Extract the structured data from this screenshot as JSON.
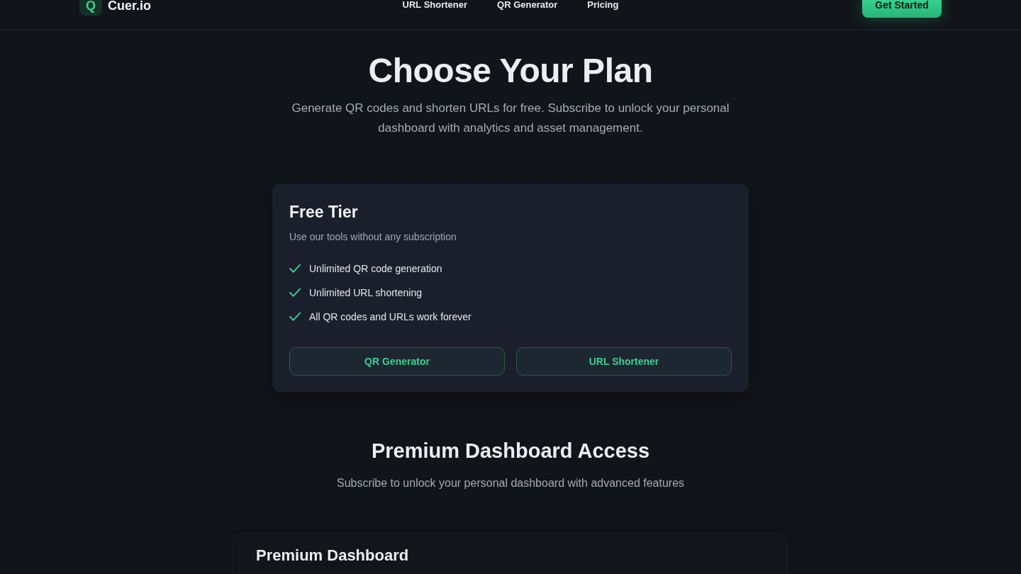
{
  "header": {
    "logo": {
      "mark": "Q",
      "name": "Cuer.io"
    },
    "nav": [
      {
        "label": "URL Shortener"
      },
      {
        "label": "QR Generator"
      },
      {
        "label": "Pricing"
      }
    ],
    "cta": "Get Started"
  },
  "hero": {
    "title": "Choose Your Plan",
    "subtitle": "Generate QR codes and shorten URLs for free. Subscribe to unlock your personal dashboard with analytics and asset management."
  },
  "free_tier": {
    "title": "Free Tier",
    "description": "Use our tools without any subscription",
    "features": [
      "Unlimited QR code generation",
      "Unlimited URL shortening",
      "All QR codes and URLs work forever"
    ],
    "buttons": [
      "QR Generator",
      "URL Shortener"
    ]
  },
  "premium": {
    "title": "Premium Dashboard Access",
    "subtitle": "Subscribe to unlock your personal dashboard with advanced features"
  },
  "premium_card": {
    "title": "Premium Dashboard"
  }
}
